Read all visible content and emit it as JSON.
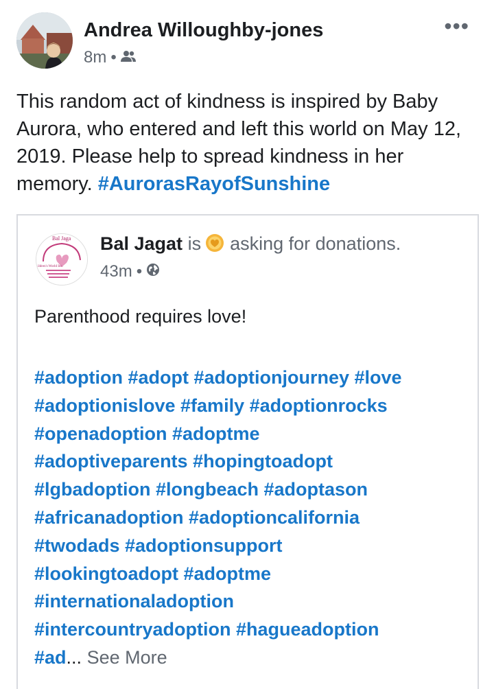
{
  "post": {
    "author": "Andrea Willoughby-jones",
    "time": "8m",
    "audience_icon": "friends-icon",
    "more_icon": "more-options-icon",
    "text": "This random act of kindness is inspired by Baby Aurora, who entered and left this world on May 12, 2019. Please help to spread kindness in her memory.",
    "hashtag": "#AurorasRayofSunshine"
  },
  "shared": {
    "page_name": "Bal Jagat",
    "is_word": "is",
    "activity": "asking for donations.",
    "activity_icon": "donation-coin-icon",
    "time": "43m",
    "audience_icon": "globe-icon",
    "logo_text": "Bal Jaga",
    "logo_subtext": "ildren's World Inc.",
    "body": "Parenthood requires love!",
    "hashtag_lines": [
      "#adoption #adopt #adoptionjourney #love",
      "#adoptionislove #family #adoptionrocks",
      "#openadoption #adoptme",
      "#adoptiveparents #hopingtoadopt",
      "#lgbadoption #longbeach #adoptason",
      "#africanadoption  #adoptioncalifornia",
      "#twodads #adoptionsupport",
      "#lookingtoadopt #adoptme",
      "#internationaladoption",
      "#intercountryadoption #hagueadoption"
    ],
    "truncated_tag": "#ad",
    "ellipsis": "...",
    "see_more": "See More"
  },
  "colors": {
    "link": "#1877c9",
    "text": "#1c1e21",
    "meta": "#606770",
    "border": "#d8dadf"
  }
}
